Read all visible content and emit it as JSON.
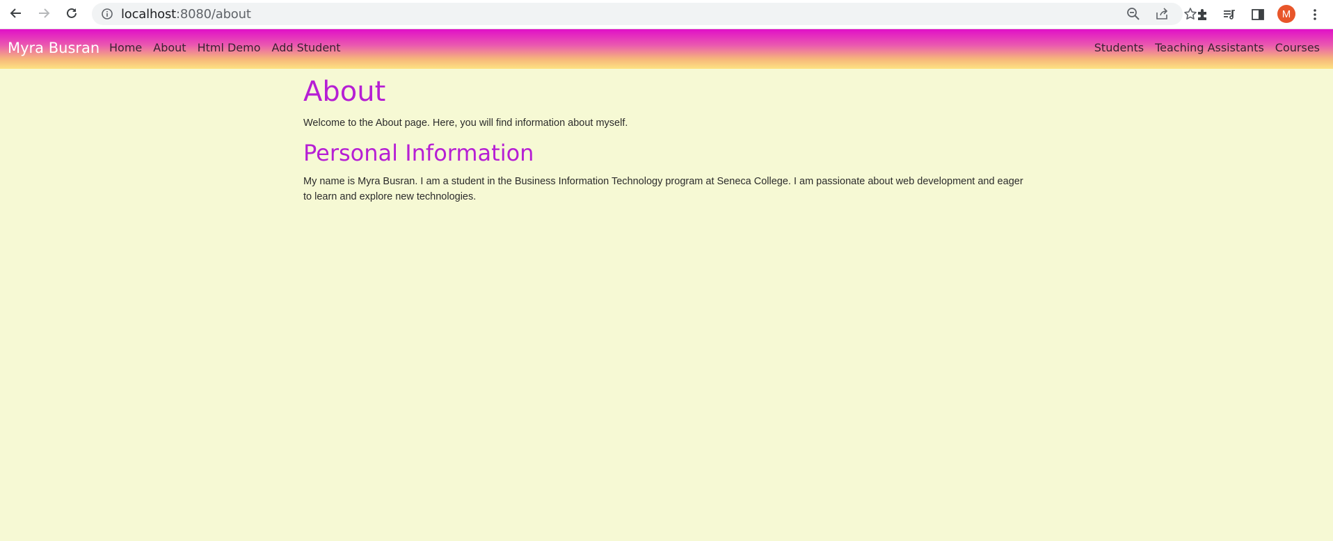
{
  "browser": {
    "url_host": "localhost",
    "url_rest": ":8080/about",
    "avatar_letter": "M"
  },
  "navbar": {
    "brand": "Myra Busran",
    "left_links": [
      "Home",
      "About",
      "Html Demo",
      "Add Student"
    ],
    "right_links": [
      "Students",
      "Teaching Assistants",
      "Courses"
    ]
  },
  "page": {
    "title": "About",
    "intro": "Welcome to the About page. Here, you will find information about myself.",
    "section_title": "Personal Information",
    "section_text": "My name is Myra Busran. I am a student in the Business Information Technology program at Seneca College. I am passionate about web development and eager to learn and explore new technologies."
  },
  "colors": {
    "page_background": "#f6f9d4",
    "heading": "#b61fd4",
    "nav_gradient_top": "#e010c8",
    "nav_gradient_bottom": "#fde383",
    "avatar": "#e8562a"
  },
  "icons": [
    "back-arrow-icon",
    "forward-arrow-icon",
    "reload-icon",
    "info-icon",
    "zoom-out-icon",
    "share-icon",
    "star-icon",
    "extensions-icon",
    "reading-list-icon",
    "side-panel-icon",
    "more-vert-icon"
  ]
}
